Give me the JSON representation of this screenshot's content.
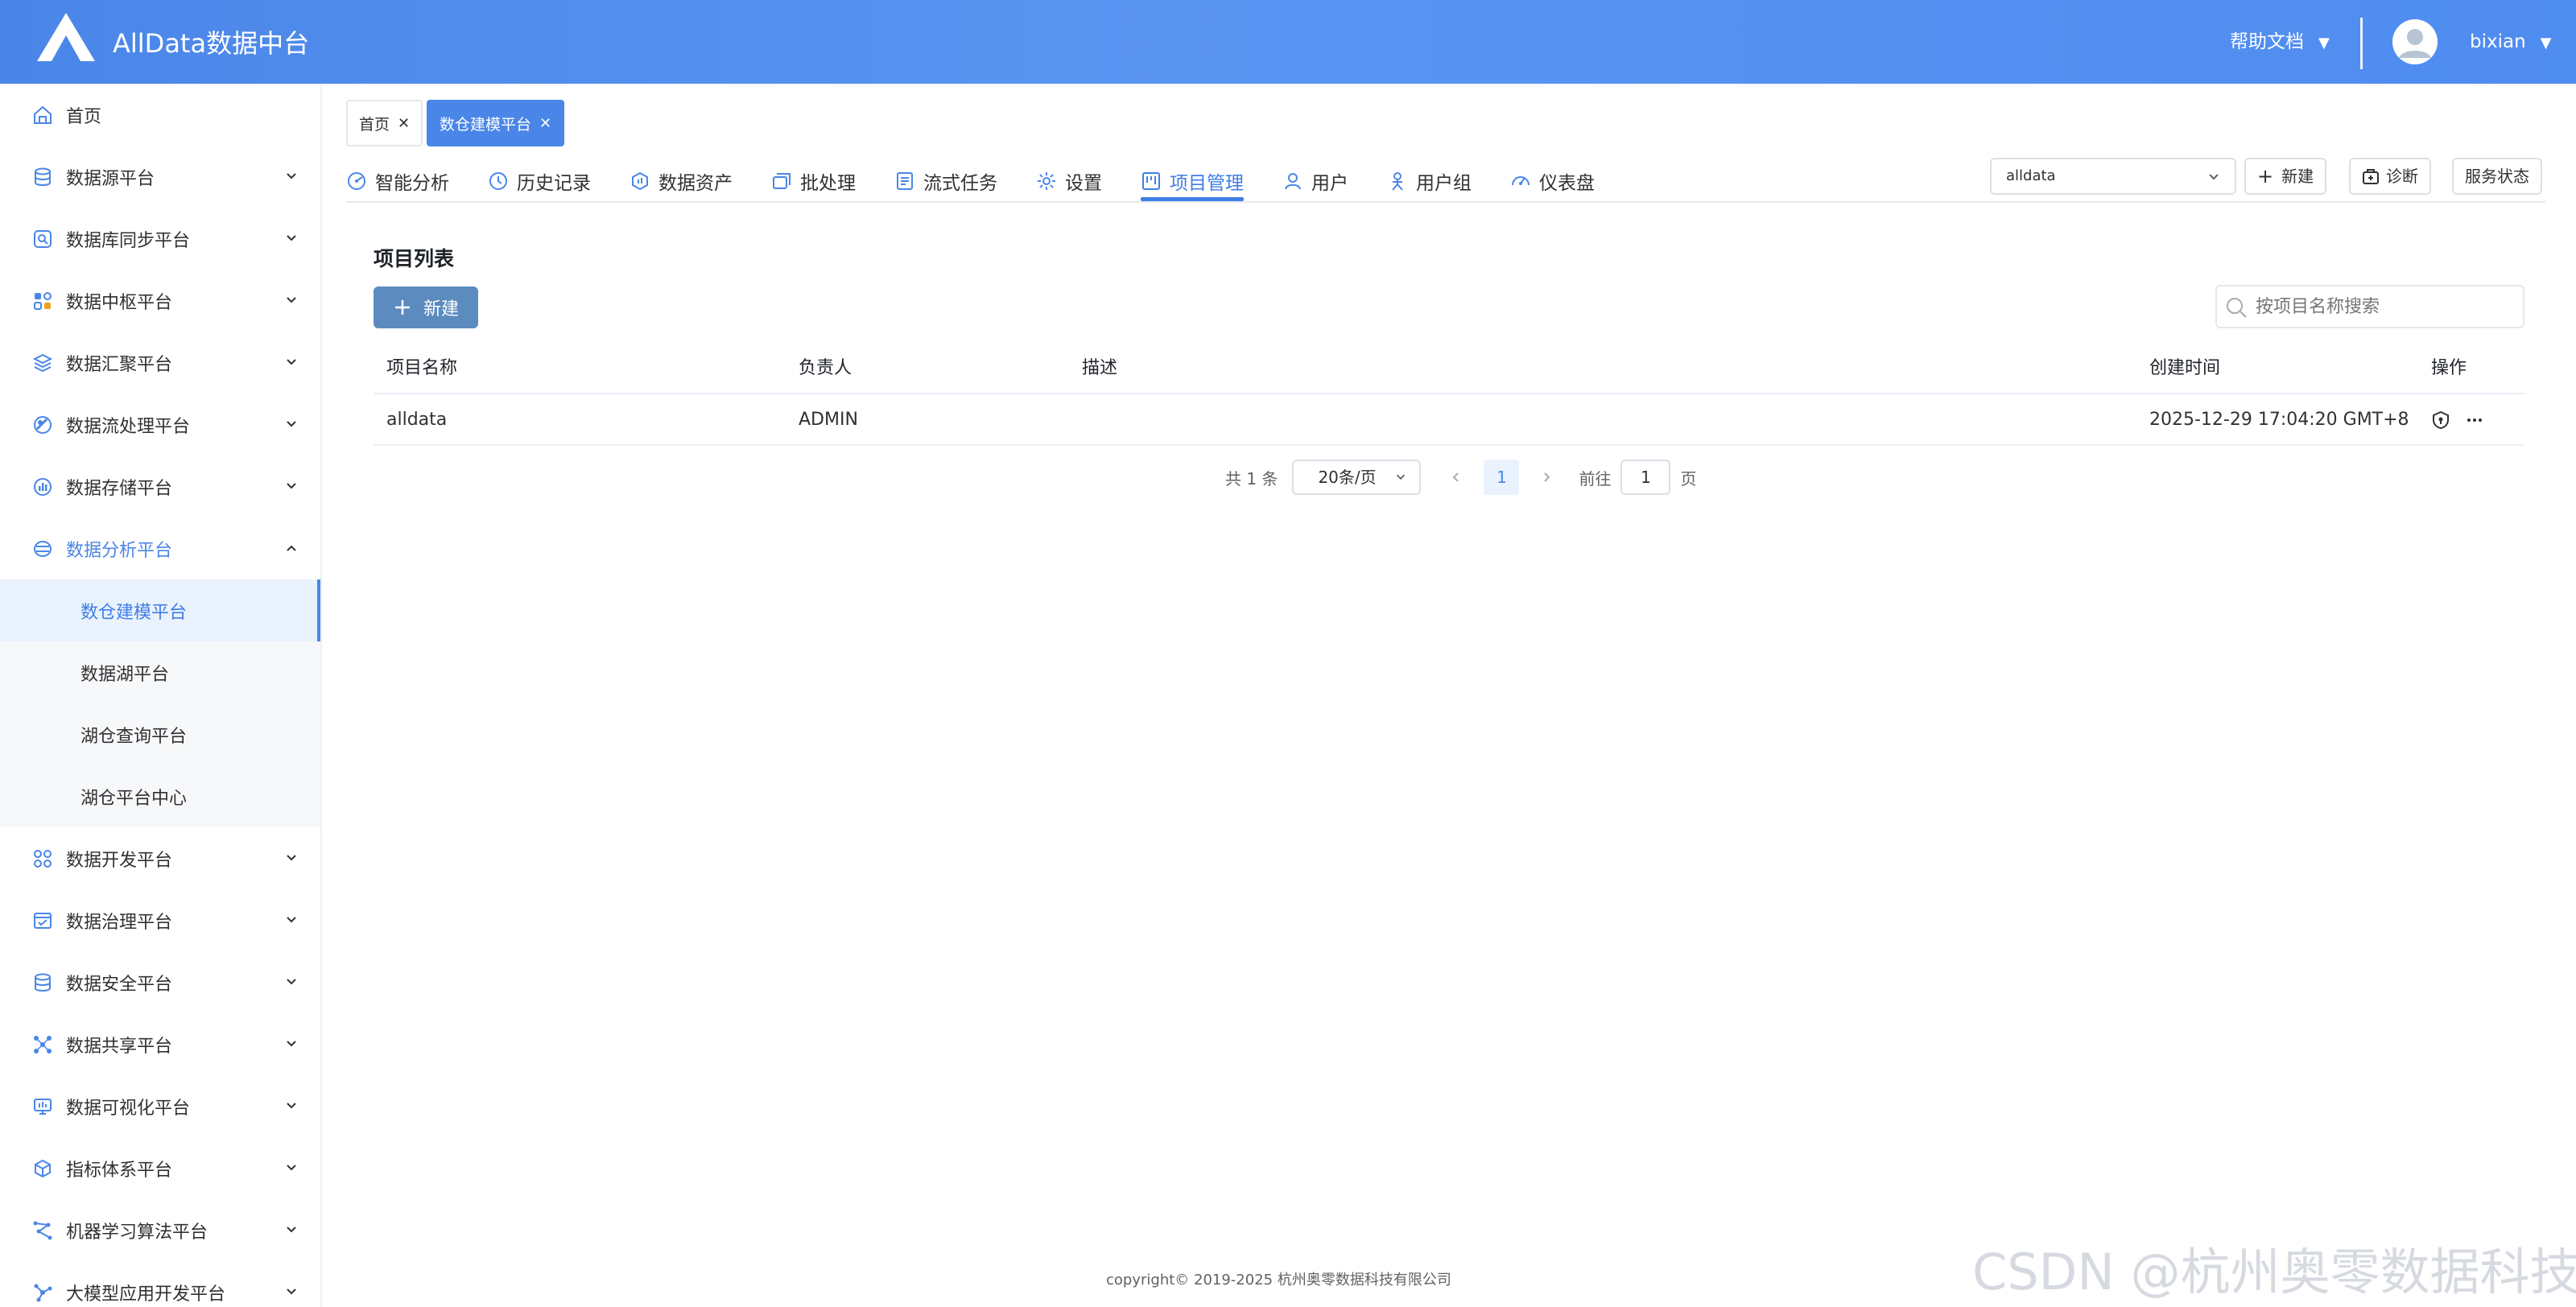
{
  "header": {
    "app_title": "AllData数据中台",
    "help_label": "帮助文档",
    "username": "bixian"
  },
  "sidebar": {
    "items": [
      {
        "label": "首页",
        "icon": "home-icon"
      },
      {
        "label": "数据源平台",
        "icon": "database-icon"
      },
      {
        "label": "数据库同步平台",
        "icon": "sync-icon"
      },
      {
        "label": "数据中枢平台",
        "icon": "hub-icon"
      },
      {
        "label": "数据汇聚平台",
        "icon": "layers-icon"
      },
      {
        "label": "数据流处理平台",
        "icon": "stream-icon"
      },
      {
        "label": "数据存储平台",
        "icon": "storage-icon"
      },
      {
        "label": "数据分析平台",
        "icon": "analysis-icon"
      }
    ],
    "submenu": [
      {
        "label": "数仓建模平台",
        "active": true
      },
      {
        "label": "数据湖平台"
      },
      {
        "label": "湖仓查询平台"
      },
      {
        "label": "湖仓平台中心"
      }
    ],
    "items_after": [
      {
        "label": "数据开发平台",
        "icon": "dev-icon"
      },
      {
        "label": "数据治理平台",
        "icon": "governance-icon"
      },
      {
        "label": "数据安全平台",
        "icon": "security-icon"
      },
      {
        "label": "数据共享平台",
        "icon": "share-icon"
      },
      {
        "label": "数据可视化平台",
        "icon": "monitor-icon"
      },
      {
        "label": "指标体系平台",
        "icon": "cube-icon"
      },
      {
        "label": "机器学习算法平台",
        "icon": "ml-icon"
      },
      {
        "label": "大模型应用开发平台",
        "icon": "llm-icon"
      }
    ]
  },
  "tags": [
    {
      "label": "首页"
    },
    {
      "label": "数仓建模平台",
      "active": true
    }
  ],
  "tabs": [
    {
      "label": "智能分析",
      "icon": "smart-analysis-icon"
    },
    {
      "label": "历史记录",
      "icon": "history-icon"
    },
    {
      "label": "数据资产",
      "icon": "data-asset-icon"
    },
    {
      "label": "批处理",
      "icon": "batch-icon"
    },
    {
      "label": "流式任务",
      "icon": "stream-task-icon"
    },
    {
      "label": "设置",
      "icon": "gear-icon"
    },
    {
      "label": "项目管理",
      "icon": "project-icon",
      "active": true
    },
    {
      "label": "用户",
      "icon": "user-icon"
    },
    {
      "label": "用户组",
      "icon": "user-group-icon"
    },
    {
      "label": "仪表盘",
      "icon": "dashboard-icon"
    }
  ],
  "toolbar": {
    "project_value": "alldata",
    "new_label": "新建",
    "diagnose_label": "诊断",
    "status_label": "服务状态"
  },
  "main": {
    "section_title": "项目列表",
    "new_button": "新建",
    "search_placeholder": "按项目名称搜索",
    "columns": [
      "项目名称",
      "负责人",
      "描述",
      "创建时间",
      "操作"
    ],
    "rows": [
      {
        "name": "alldata",
        "owner": "ADMIN",
        "desc": "",
        "created": "2025-12-29 17:04:20 GMT+8"
      }
    ]
  },
  "pagination": {
    "total": "共 1 条",
    "page_size": "20条/页",
    "current_page": "1",
    "goto_label": "前往",
    "goto_value": "1",
    "page_suffix": "页"
  },
  "footer": {
    "copyright": "copyright© 2019-2025 杭州奥零数据科技有限公司",
    "watermark": "CSDN @杭州奥零数据科技"
  },
  "colors": {
    "accent": "#4a86e8",
    "header_gradient_start": "#4a86e8",
    "new_button": "#5b8bbf"
  }
}
